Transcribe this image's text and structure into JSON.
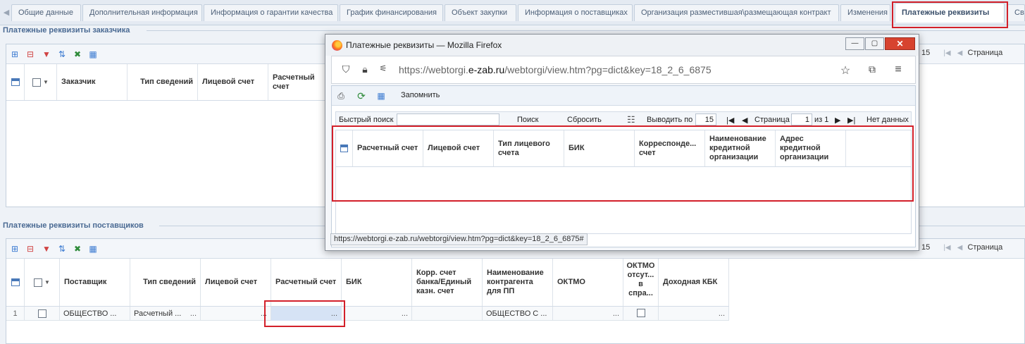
{
  "tabs": {
    "items": [
      "Общие данные",
      "Дополнительная информация",
      "Информация о гарантии качества",
      "График финансирования",
      "Объект закупки",
      "Информация о поставщиках",
      "Организация разместившая\\размещающая контракт",
      "Изменения",
      "Платежные реквизиты",
      "Све"
    ],
    "active": "Платежные реквизиты"
  },
  "customer_panel": {
    "title": "Платежные реквизиты заказчика",
    "columns": [
      "Заказчик",
      "Тип сведений",
      "Лицевой счет",
      "Расчетный счет"
    ],
    "pager_count": "15",
    "pager_page_label": "Страница"
  },
  "supplier_panel": {
    "title": "Платежные реквизиты поставщиков",
    "columns": [
      "Поставщик",
      "Тип сведений",
      "Лицевой счет",
      "Расчетный счет",
      "БИК",
      "Корр. счет банка/Единый казн. счет",
      "Наименование контрагента для ПП",
      "ОКТМО",
      "ОКТМО отсут... в спра...",
      "Доходная КБК"
    ],
    "row": {
      "num": "1",
      "supplier": "ОБЩЕСТВО ...",
      "type": "Расчетный ...",
      "ellipsis": "...",
      "counterparty": "ОБЩЕСТВО С ..."
    },
    "pager_count": "15",
    "pager_page_label": "Страница"
  },
  "popup": {
    "window_title": "Платежные реквизиты — Mozilla Firefox",
    "url_prefix": "https://webtorgi.",
    "url_domain": "e-zab.ru",
    "url_suffix": "/webtorgi/view.htm?pg=dict&key=18_2_6_6875",
    "toolbar_remember": "Запомнить",
    "search_label": "Быстрый поиск",
    "search_value": "",
    "search_button": "Поиск",
    "reset_button": "Сбросить",
    "show_by_label": "Выводить по",
    "show_by_value": "15",
    "page_label": "Страница",
    "page_value": "1",
    "page_of": "из 1",
    "no_data": "Нет данных",
    "columns": [
      "Расчетный счет",
      "Лицевой счет",
      "Тип лицевого счета",
      "БИК",
      "Корреспонде... счет",
      "Наименование кредитной организации",
      "Адрес кредитной организации"
    ],
    "status_url": "https://webtorgi.e-zab.ru/webtorgi/view.htm?pg=dict&key=18_2_6_6875#"
  },
  "colors": {
    "highlight": "#d3202a",
    "accent": "#4a6a93"
  }
}
